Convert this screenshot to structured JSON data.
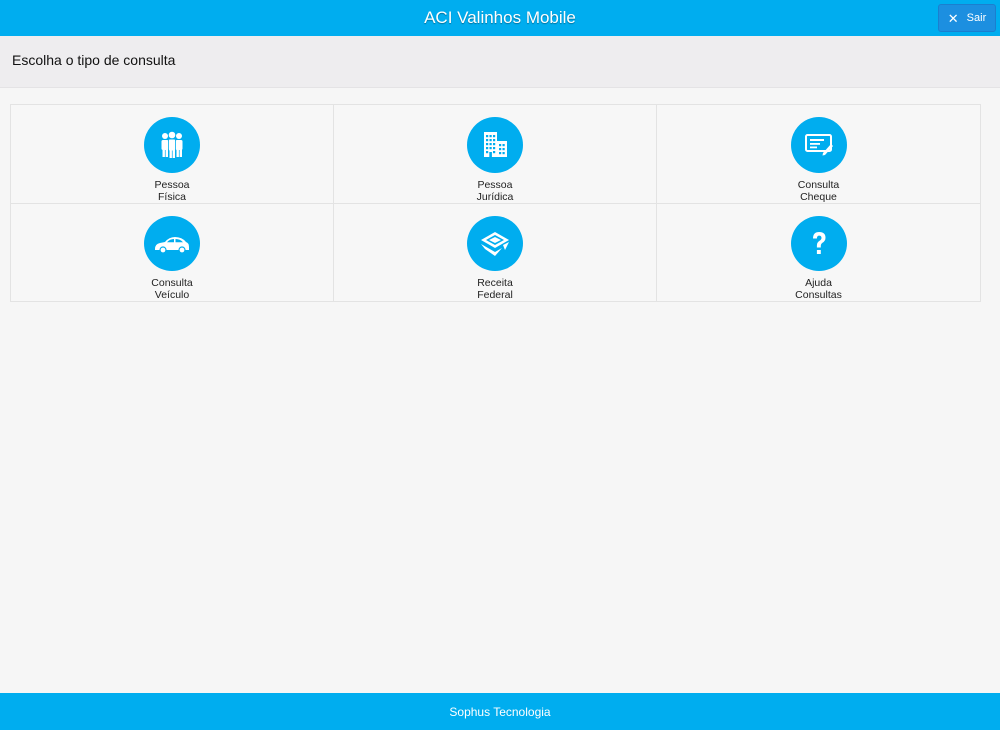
{
  "header": {
    "title": "ACI Valinhos Mobile",
    "exit_label": "Sair"
  },
  "subheader": {
    "title": "Escolha o tipo de consulta"
  },
  "tiles": [
    {
      "line1": "Pessoa",
      "line2": "Física",
      "icon": "people-icon"
    },
    {
      "line1": "Pessoa",
      "line2": "Jurídica",
      "icon": "buildings-icon"
    },
    {
      "line1": "Consulta",
      "line2": "Cheque",
      "icon": "cheque-icon"
    },
    {
      "line1": "Consulta",
      "line2": "Veículo",
      "icon": "car-icon"
    },
    {
      "line1": "Receita",
      "line2": "Federal",
      "icon": "receita-federal-icon"
    },
    {
      "line1": "Ajuda",
      "line2": "Consultas",
      "icon": "help-icon"
    }
  ],
  "footer": {
    "text": "Sophus Tecnologia"
  },
  "colors": {
    "brand": "#00adef",
    "exit_button": "#1c8fe0",
    "background": "#f6f6f6"
  }
}
